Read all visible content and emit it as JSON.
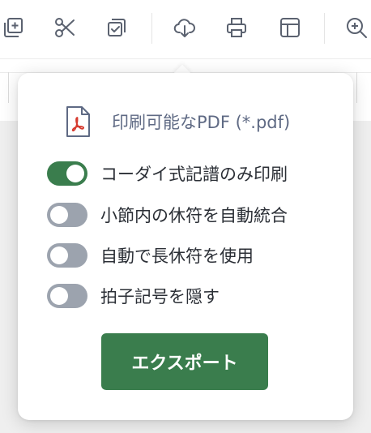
{
  "toolbar": {
    "tools": [
      {
        "icon": "add-page-icon"
      },
      {
        "icon": "scissors-icon"
      },
      {
        "icon": "copy-check-icon"
      },
      {
        "icon": "cloud-download-icon"
      },
      {
        "icon": "printer-icon"
      },
      {
        "icon": "layout-icon"
      },
      {
        "icon": "zoom-in-icon"
      }
    ]
  },
  "export_popover": {
    "format_icon": "pdf-file-icon",
    "format_label": "印刷可能なPDF (*.pdf)",
    "options": [
      {
        "label": "コーダイ式記譜のみ印刷",
        "on": true
      },
      {
        "label": "小節内の休符を自動統合",
        "on": false
      },
      {
        "label": "自動で長休符を使用",
        "on": false
      },
      {
        "label": "拍子記号を隠す",
        "on": false
      }
    ],
    "export_button": "エクスポート"
  },
  "colors": {
    "accent_green": "#3a7d4d",
    "toggle_off": "#9ca3ae",
    "icon_stroke": "#5b6270"
  }
}
